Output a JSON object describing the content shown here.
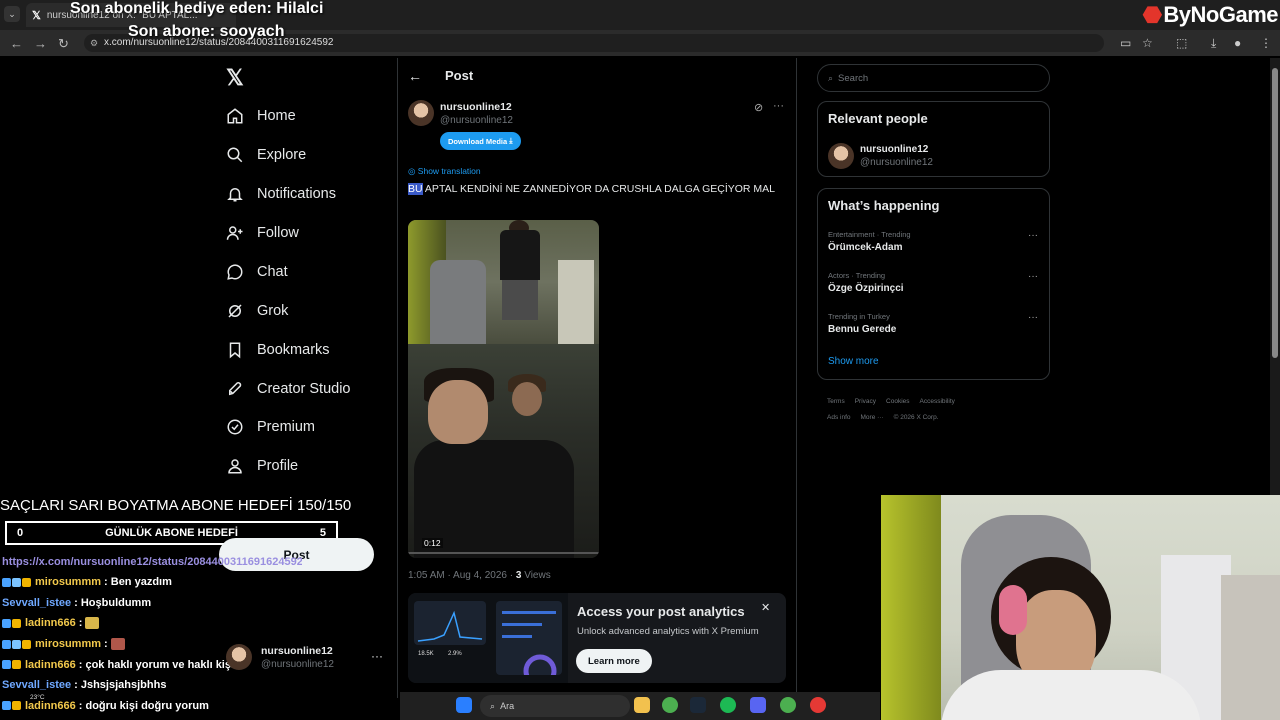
{
  "browser": {
    "tab_title": "nursuonline12 on X: \"BU APTAL...",
    "url": "x.com/nursuonline12/status/2084400311691624592",
    "brand": "ByNoGame"
  },
  "stream_overlay": {
    "top_gift": "Son abonelik hediye eden: Hilalci",
    "last_sub": "Son abone: sooyach",
    "goal_title": "SAÇLARI SARI BOYATMA ABONE HEDEFİ 150/150",
    "daily_goal_label": "GÜNLÜK ABONE HEDEFİ",
    "daily_goal_current": "0",
    "daily_goal_target": "5"
  },
  "nav": {
    "items": [
      {
        "label": "Home",
        "icon": "home-icon"
      },
      {
        "label": "Explore",
        "icon": "search-icon"
      },
      {
        "label": "Notifications",
        "icon": "bell-icon"
      },
      {
        "label": "Follow",
        "icon": "person-plus-icon"
      },
      {
        "label": "Chat",
        "icon": "chat-icon"
      },
      {
        "label": "Grok",
        "icon": "grok-icon"
      },
      {
        "label": "Bookmarks",
        "icon": "bookmark-icon"
      },
      {
        "label": "Creator Studio",
        "icon": "rocket-icon"
      },
      {
        "label": "Premium",
        "icon": "verified-icon"
      },
      {
        "label": "Profile",
        "icon": "person-icon"
      }
    ],
    "post_button": "Post",
    "account_name": "nursuonline12",
    "account_handle": "@nursuonline12"
  },
  "chat": {
    "link": "https://x.com/nursuonline12/status/2084400311691624592",
    "messages": [
      {
        "user": "mirosummm",
        "text": ": Ben yazdım",
        "color": "yellow",
        "badges": true
      },
      {
        "user": "Sevvall_istee",
        "text": ": Hoşbuldumm",
        "color": "blue",
        "badges": false
      },
      {
        "user": "ladinn666",
        "text": ":",
        "color": "yellow",
        "badges": true,
        "emote": true
      },
      {
        "user": "mirosummm",
        "text": ":",
        "color": "yellow",
        "badges": true,
        "emote": true
      },
      {
        "user": "ladinn666",
        "text": ": çok haklı yorum ve haklı kişi",
        "color": "yellow",
        "badges": true
      },
      {
        "user": "Sevvall_istee",
        "text": ": Jshsjsjahsjbhhs",
        "color": "blue",
        "badges": false
      },
      {
        "user": "ladinn666",
        "text": ": doğru kişi doğru yorum",
        "color": "yellow",
        "badges": true
      }
    ]
  },
  "post": {
    "header": "Post",
    "author_name": "nursuonline12",
    "author_handle": "@nursuonline12",
    "download_label": "Download Media",
    "show_translation": "Show translation",
    "text_highlight": "BU",
    "text_rest": " APTAL KENDİNİ NE ZANNEDİYOR DA CRUSHLA DALGA GEÇİYOR MAL",
    "video_time": "0:12",
    "meta_time": "1:05 AM · Aug 4, 2026 · ",
    "views_count": "3",
    "views_label": " Views"
  },
  "analytics": {
    "title": "Access your post analytics",
    "description": "Unlock advanced analytics with X Premium",
    "button": "Learn more",
    "stat1": "18.5K",
    "stat2": "2.9%"
  },
  "right": {
    "search_placeholder": "Search",
    "relevant_title": "Relevant people",
    "rp_name": "nursuonline12",
    "rp_handle": "@nursuonline12",
    "happening_title": "What’s happening",
    "trends": [
      {
        "category": "Entertainment · Trending",
        "title": "Örümcek-Adam"
      },
      {
        "category": "Actors · Trending",
        "title": "Özge Özpirinçci"
      },
      {
        "category": "Trending in Turkey",
        "title": "Bennu Gerede"
      }
    ],
    "show_more": "Show more",
    "footer_line1": [
      "Terms",
      "Privacy",
      "Cookies",
      "Accessibility"
    ],
    "footer_line2": [
      "Ads info",
      "More ···",
      "© 2026 X Corp."
    ]
  },
  "taskbar": {
    "search_label": "Ara",
    "weather": "23°C"
  }
}
